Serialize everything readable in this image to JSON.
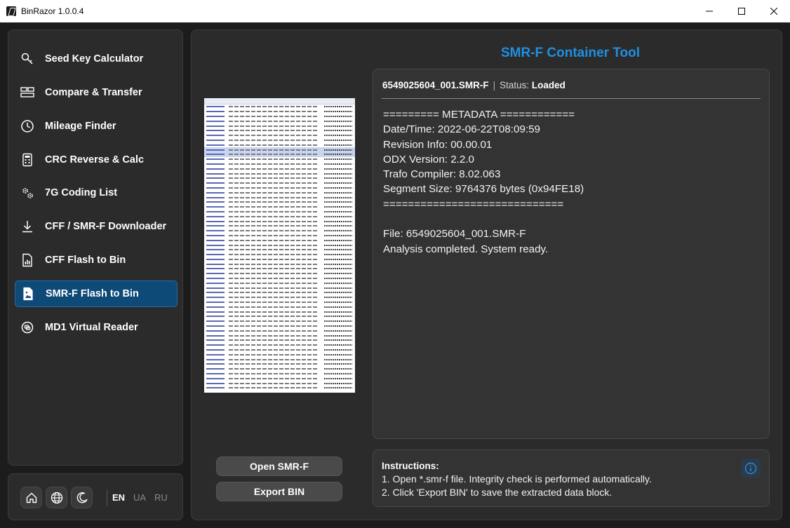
{
  "window": {
    "title": "BinRazor 1.0.0.4"
  },
  "sidebar": {
    "items": [
      {
        "label": "Seed Key Calculator",
        "icon": "key-icon"
      },
      {
        "label": "Compare & Transfer",
        "icon": "compare-icon"
      },
      {
        "label": "Mileage Finder",
        "icon": "clock-icon"
      },
      {
        "label": "CRC Reverse & Calc",
        "icon": "calculator-icon"
      },
      {
        "label": "7G Coding List",
        "icon": "gears-icon"
      },
      {
        "label": "CFF / SMR-F Downloader",
        "icon": "download-icon"
      },
      {
        "label": "CFF Flash to Bin",
        "icon": "file-chart-icon"
      },
      {
        "label": "SMR-F Flash to Bin",
        "icon": "file-image-icon",
        "active": true
      },
      {
        "label": "MD1 Virtual Reader",
        "icon": "chip-icon"
      }
    ]
  },
  "footer": {
    "languages": [
      "EN",
      "UA",
      "RU"
    ],
    "active_language": "EN"
  },
  "main": {
    "title": "SMR-F Container Tool",
    "file_name": "6549025604_001.SMR-F",
    "separator": "|",
    "status_label": "Status:",
    "status_value": "Loaded",
    "metadata_lines": [
      "========= METADATA ============",
      "Date/Time: 2022-06-22T08:09:59",
      "Revision Info: 00.00.01",
      "ODX Version: 2.2.0",
      "Trafo Compiler: 8.02.063",
      "Segment Size: 9764376 bytes (0x94FE18)",
      "=============================",
      "",
      "File: 6549025604_001.SMR-F",
      "Analysis completed. System ready."
    ],
    "buttons": {
      "open": "Open SMR-F",
      "export": "Export BIN"
    },
    "instructions": {
      "title": "Instructions:",
      "lines": [
        "1. Open *.smr-f file. Integrity check is performed automatically.",
        "2. Click 'Export BIN' to save the extracted data block."
      ]
    }
  },
  "colors": {
    "accent": "#1f8fe0",
    "active_nav": "#0e4a78",
    "panel": "#2b2b2b",
    "card": "#333333"
  }
}
